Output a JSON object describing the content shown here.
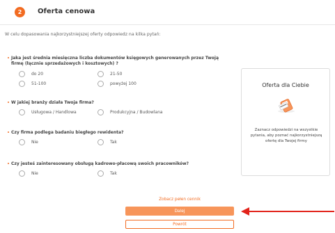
{
  "header": {
    "step_number": "2",
    "title": "Oferta cenowa"
  },
  "intro": "W celu dopasowania najkorzystniejszej oferty odpowiedz na kilka pytań:",
  "questions": [
    {
      "text": "Jaka jest średnia miesięczna liczba dokumentów księgowych generowanych przez Twoją firmę (łącznie sprzedażowych i kosztowych) ?",
      "options": [
        "do 20",
        "21-50",
        "51-100",
        "powyżej 100"
      ]
    },
    {
      "text": "W jakiej branży działa Twoja firma?",
      "options": [
        "Usługowa / Handlowa",
        "Produkcyjna / Budowlana"
      ]
    },
    {
      "text": "Czy firma podlega badaniu biegłego rewidenta?",
      "options": [
        "Nie",
        "Tak"
      ]
    },
    {
      "text": "Czy jesteś zainteresowany obsługą kadrowo-płacową swoich pracowników?",
      "options": [
        "Nie",
        "Tak"
      ]
    }
  ],
  "side_card": {
    "title": "Oferta dla Ciebie",
    "text": "Zaznacz odpowiedzi na wszystkie pytania, aby poznać najkorzystniejszą ofertę dla Twojej firmy",
    "icon": "payment-terminal-icon"
  },
  "actions": {
    "pricelist_link": "Zobacz pełen cennik",
    "next_label": "Dalej",
    "back_label": "Powrót"
  },
  "colors": {
    "accent": "#f26b21",
    "button_fill": "#f7955a",
    "annotation_arrow": "#e2231a"
  }
}
